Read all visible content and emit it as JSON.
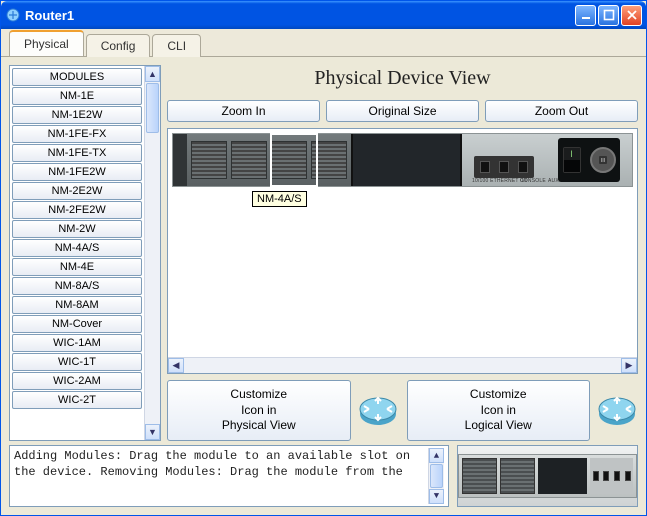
{
  "window": {
    "title": "Router1"
  },
  "tabs": {
    "physical": "Physical",
    "config": "Config",
    "cli": "CLI"
  },
  "heading": "Physical Device View",
  "zoom": {
    "in": "Zoom In",
    "original": "Original Size",
    "out": "Zoom Out"
  },
  "modules": {
    "header": "MODULES",
    "items": [
      "NM-1E",
      "NM-1E2W",
      "NM-1FE-FX",
      "NM-1FE-TX",
      "NM-1FE2W",
      "NM-2E2W",
      "NM-2FE2W",
      "NM-2W",
      "NM-4A/S",
      "NM-4E",
      "NM-8A/S",
      "NM-8AM",
      "NM-Cover",
      "WIC-1AM",
      "WIC-1T",
      "WIC-2AM",
      "WIC-2T"
    ]
  },
  "tooltip": "NM-4A/S",
  "port_labels": {
    "ethernet": "10/100 ETHERNET 0/0",
    "console": "CONSOLE",
    "aux": "AUX"
  },
  "customize": {
    "physical": "Customize\nIcon in\nPhysical View",
    "logical": "Customize\nIcon in\nLogical View"
  },
  "instructions": "Adding Modules: Drag the module to an available slot on the device.\nRemoving Modules: Drag the module from the"
}
